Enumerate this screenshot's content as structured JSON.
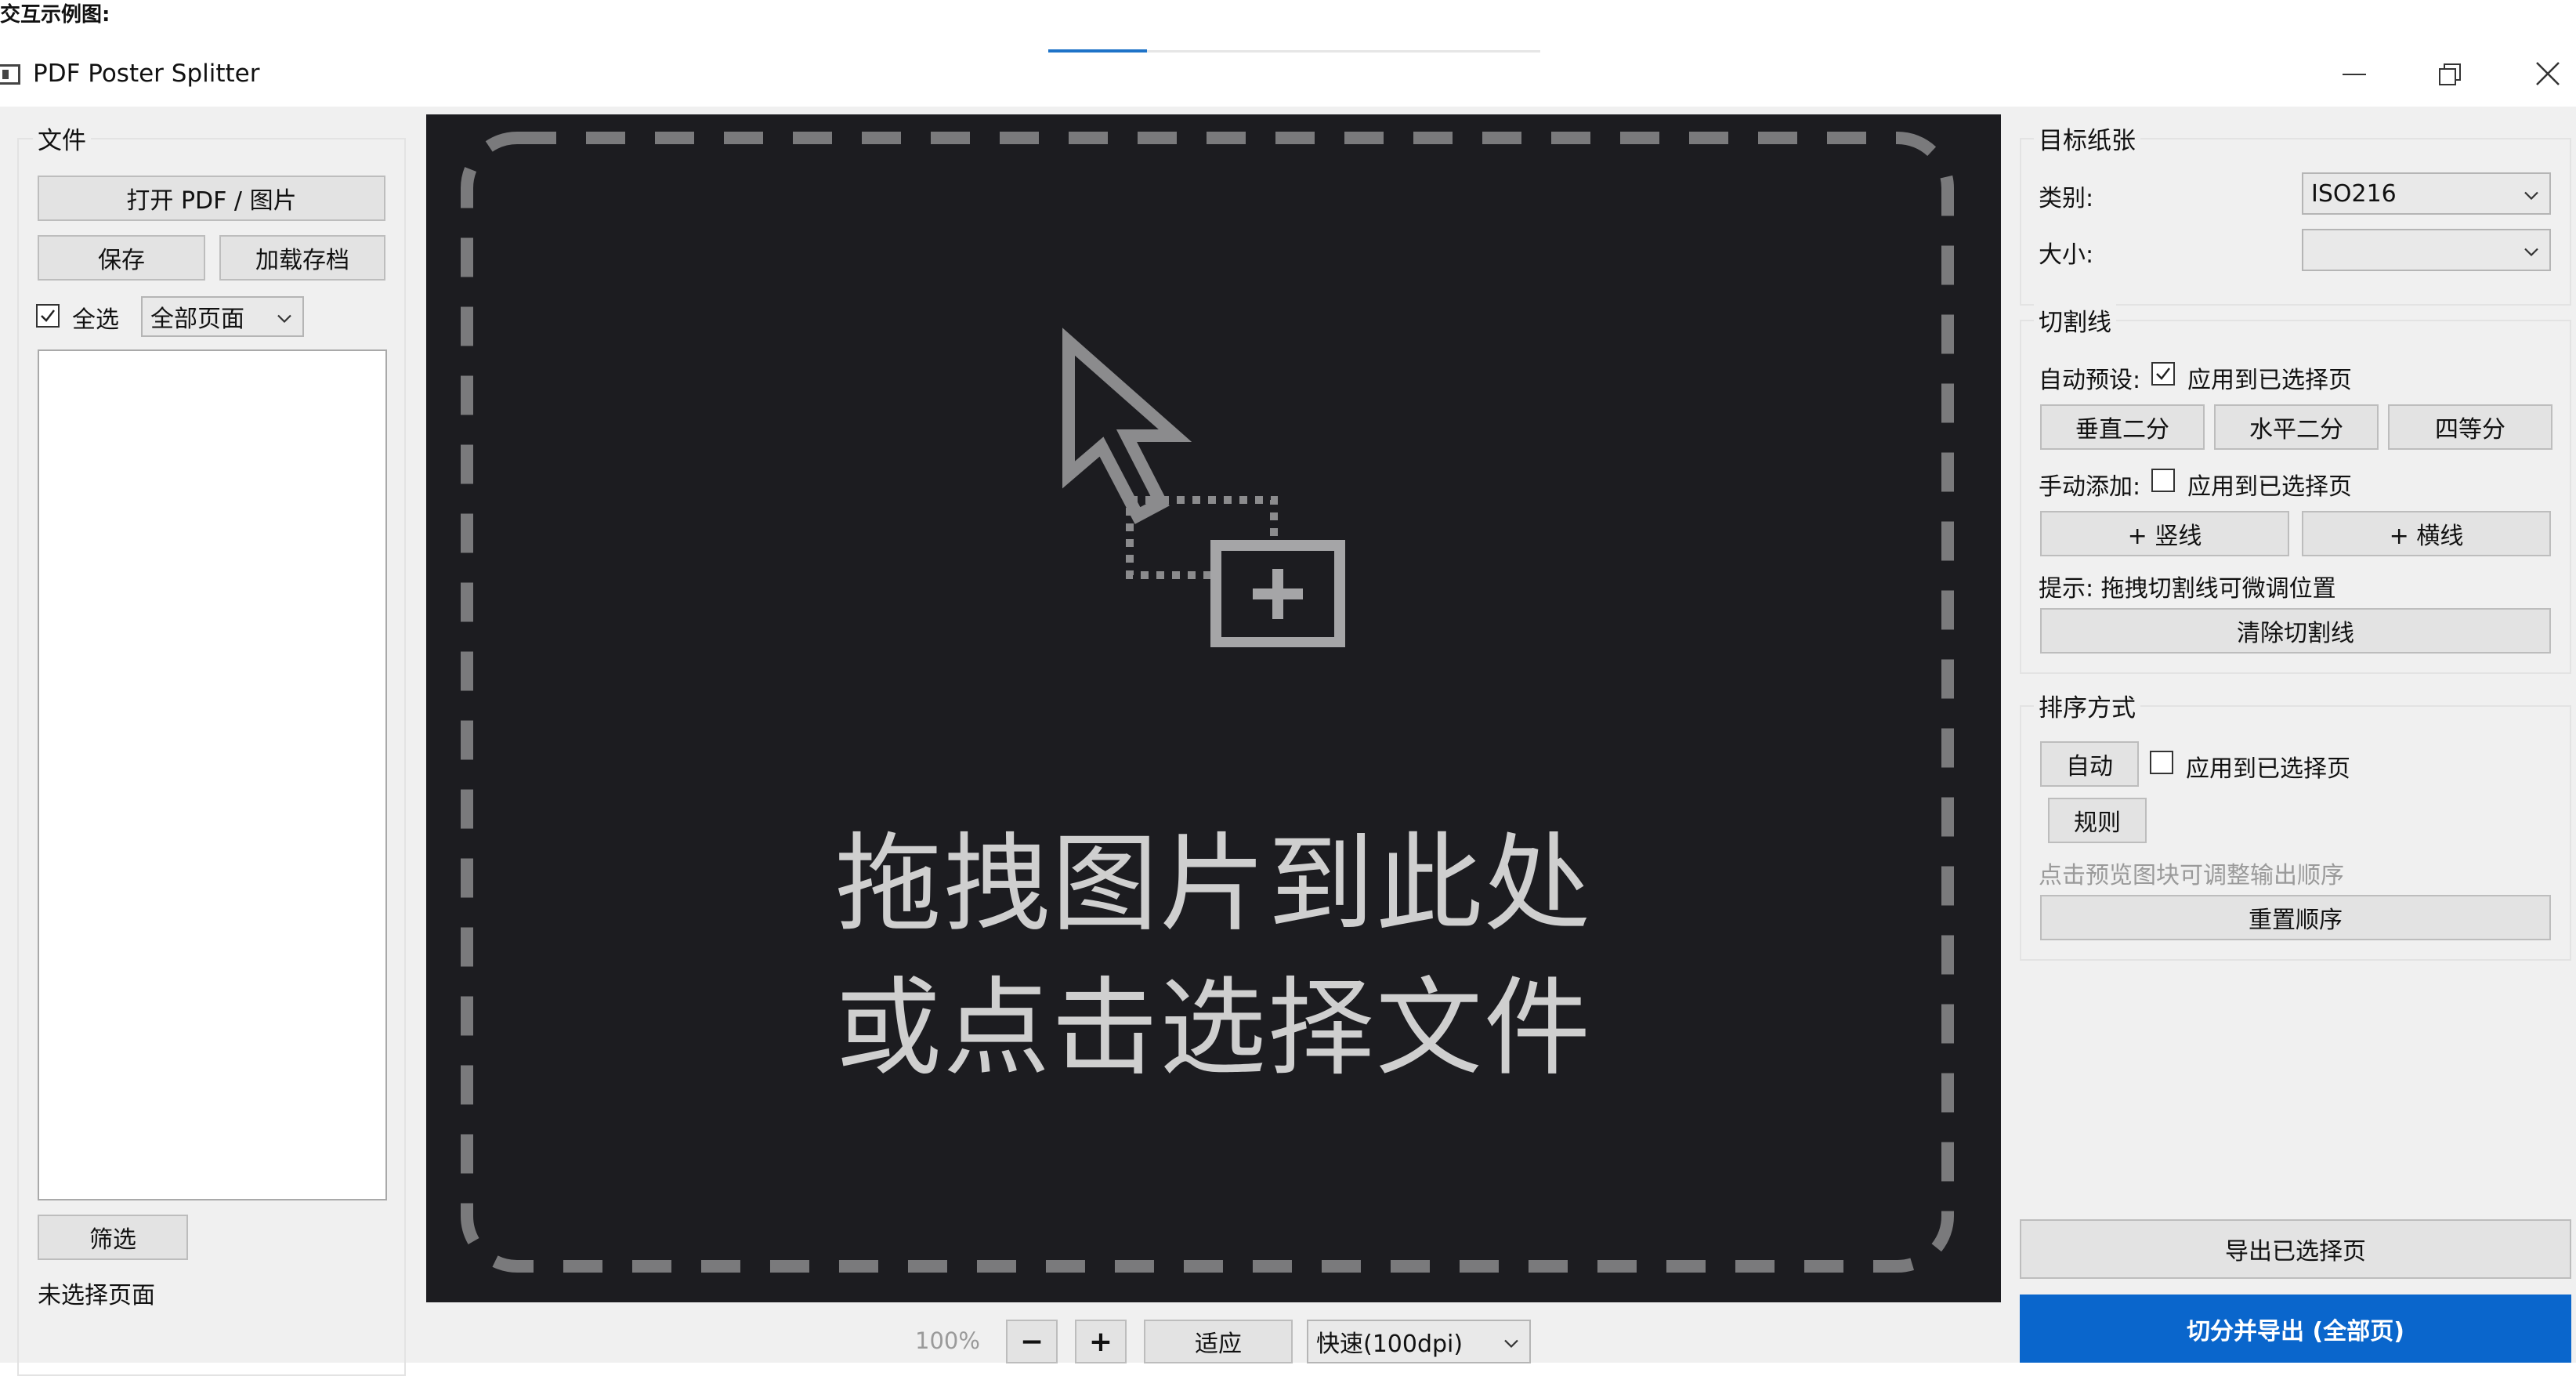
{
  "caption": "交互示例图:",
  "window": {
    "title": "PDF Poster Splitter"
  },
  "left": {
    "group_title": "文件",
    "open_button": "打开 PDF / 图片",
    "save_button": "保存",
    "load_button": "加载存档",
    "select_all_label": "全选",
    "select_all_checked": true,
    "page_filter_value": "全部页面",
    "filter_button": "筛选",
    "status": "未选择页面"
  },
  "canvas": {
    "line1": "拖拽图片到此处",
    "line2": "或点击选择文件",
    "background": "#1c1c20"
  },
  "bottom": {
    "zoom": "100%",
    "minus": "−",
    "plus": "+",
    "fit_button": "适应",
    "quality_value": "快速(100dpi)"
  },
  "right": {
    "paper": {
      "title": "目标纸张",
      "category_label": "类别:",
      "category_value": "ISO216",
      "size_label": "大小:",
      "size_value": ""
    },
    "cut": {
      "title": "切割线",
      "auto_label": "自动预设:",
      "auto_apply_label": "应用到已选择页",
      "auto_apply_checked": true,
      "vertical_half": "垂直二分",
      "horizontal_half": "水平二分",
      "quarter": "四等分",
      "manual_label": "手动添加:",
      "manual_apply_label": "应用到已选择页",
      "manual_apply_checked": false,
      "add_vertical": "+ 竖线",
      "add_horizontal": "+ 横线",
      "hint": "提示: 拖拽切割线可微调位置",
      "clear_button": "清除切割线"
    },
    "order": {
      "title": "排序方式",
      "auto_button": "自动",
      "apply_label": "应用到已选择页",
      "apply_checked": false,
      "rule_button": "规则",
      "hint": "点击预览图块可调整输出顺序",
      "reset_button": "重置顺序"
    },
    "export_selected": "导出已选择页",
    "export_all": "切分并导出 (全部页)"
  },
  "colors": {
    "accent": "#0a66cc",
    "panel": "#f0f0f0",
    "canvas": "#1c1c20"
  }
}
